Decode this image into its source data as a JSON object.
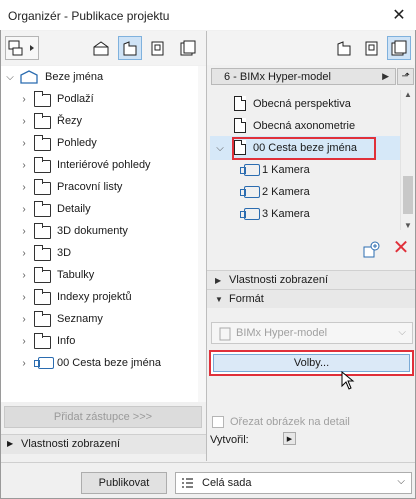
{
  "window": {
    "title": "Organizér - Publikace projektu",
    "close_glyph": "✕"
  },
  "left_tree": {
    "root": "Beze jména",
    "items": [
      "Podlaží",
      "Řezy",
      "Pohledy",
      "Interiérové pohledy",
      "Pracovní listy",
      "Detaily",
      "3D dokumenty",
      "3D",
      "Tabulky",
      "Indexy projektů",
      "Seznamy",
      "Info",
      "00 Cesta beze jména"
    ]
  },
  "left_buttons": {
    "add_shortcut": "Přidat zástupce >>>",
    "display_props": "Vlastnosti zobrazení"
  },
  "right_panel": {
    "set_name": "6 - BIMx Hyper-model",
    "items": [
      {
        "label": "Obecná perspektiva",
        "icon": "document-icon"
      },
      {
        "label": "Obecná axonometrie",
        "icon": "document-icon"
      },
      {
        "label": "00 Cesta beze jména",
        "icon": "document-icon",
        "selected": true
      },
      {
        "label": "1 Kamera",
        "icon": "camera-icon"
      },
      {
        "label": "2 Kamera",
        "icon": "camera-icon"
      },
      {
        "label": "3 Kamera",
        "icon": "camera-icon"
      }
    ],
    "section_display": "Vlastnosti zobrazení",
    "section_format": "Formát",
    "format_value": "BIMx Hyper-model",
    "options_button": "Volby...",
    "crop_label": "Ořezat obrázek na detail",
    "created_label": "Vytvořil:"
  },
  "bottom": {
    "publish_button": "Publikovat",
    "set_dropdown": "Celá sada"
  },
  "colors": {
    "highlight_red": "#e0303a",
    "selection_blue": "#d6e8f8",
    "camera_blue": "#2b6cb0"
  }
}
